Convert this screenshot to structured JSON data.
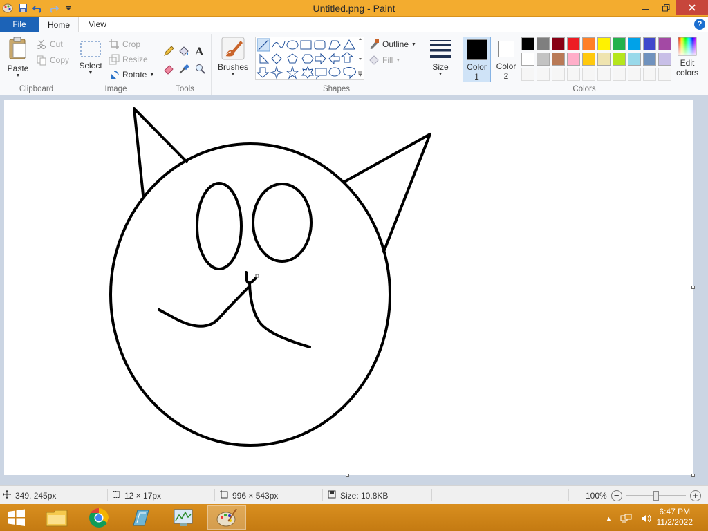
{
  "window": {
    "title": "Untitled.png - Paint"
  },
  "tabs": [
    {
      "label": "File"
    },
    {
      "label": "Home"
    },
    {
      "label": "View"
    }
  ],
  "clipboard": {
    "paste": "Paste",
    "cut": "Cut",
    "copy": "Copy",
    "label": "Clipboard"
  },
  "image": {
    "select": "Select",
    "crop": "Crop",
    "resize": "Resize",
    "rotate": "Rotate",
    "label": "Image"
  },
  "tools": {
    "label": "Tools",
    "text_glyph": "A"
  },
  "brushes": {
    "label": "Brushes"
  },
  "shapes": {
    "outline": "Outline",
    "fill": "Fill",
    "label": "Shapes"
  },
  "size": {
    "label": "Size"
  },
  "color1": {
    "line1": "Color",
    "line2": "1",
    "value": "#000000"
  },
  "color2": {
    "line1": "Color",
    "line2": "2",
    "value": "#ffffff"
  },
  "colors": {
    "label": "Colors",
    "edit_line1": "Edit",
    "edit_line2": "colors",
    "row1": [
      "#000000",
      "#7f7f7f",
      "#880015",
      "#ed1c24",
      "#ff7f27",
      "#fff200",
      "#22b14c",
      "#00a2e8",
      "#3f48cc",
      "#a349a4"
    ],
    "row2": [
      "#ffffff",
      "#c3c3c3",
      "#b97a57",
      "#ffaec9",
      "#ffc90e",
      "#efe4b0",
      "#b5e61d",
      "#99d9ea",
      "#7092be",
      "#c8bfe7"
    ]
  },
  "status": {
    "cursor": "349, 245px",
    "selection": "12 × 17px",
    "canvas_size": "996 × 543px",
    "file_size": "Size: 10.8KB",
    "zoom": "100%",
    "zoom_minus": "−",
    "zoom_plus": "+"
  },
  "taskbar": {
    "time": "6:47 PM",
    "date": "11/2/2022"
  }
}
